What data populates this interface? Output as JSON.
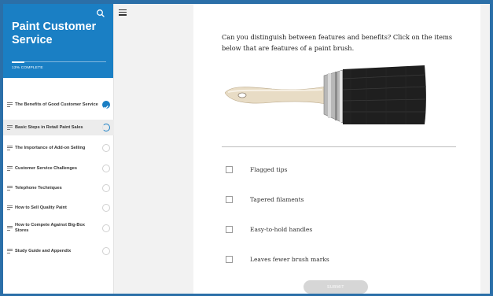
{
  "colors": {
    "brand": "#1a7fc4",
    "background": "#2b6fa8",
    "panel": "#f2f2f2",
    "submit_disabled": "#d6d6d6"
  },
  "sidebar": {
    "search_icon": "search-icon",
    "course_title": "Paint Customer Service",
    "progress_percent": 13,
    "progress_label": "13% COMPLETE",
    "lessons": [
      {
        "label": "The Benefits of Good Customer Service",
        "status": "complete"
      },
      {
        "label": "Basic Steps in Retail Paint Sales",
        "status": "in-progress"
      },
      {
        "label": "The Importance of Add-on Selling",
        "status": "not-started"
      },
      {
        "label": "Customer Service Challenges",
        "status": "not-started"
      },
      {
        "label": "Telephone Techniques",
        "status": "not-started"
      },
      {
        "label": "How to Sell Quality Paint",
        "status": "not-started"
      },
      {
        "label": "How to Compete Against Big-Box Stores",
        "status": "not-started"
      },
      {
        "label": "Study Guide and Appendix",
        "status": "not-started"
      }
    ]
  },
  "menu_icon": "hamburger-menu-icon",
  "quiz": {
    "question": "Can you distinguish between features and benefits? Click on the items below that are features of a paint brush.",
    "options": [
      {
        "label": "Flagged tips",
        "checked": false
      },
      {
        "label": "Tapered filaments",
        "checked": false
      },
      {
        "label": "Easy-to-hold handles",
        "checked": false
      },
      {
        "label": "Leaves fewer brush marks",
        "checked": false
      }
    ],
    "submit_label": "SUBMIT"
  }
}
